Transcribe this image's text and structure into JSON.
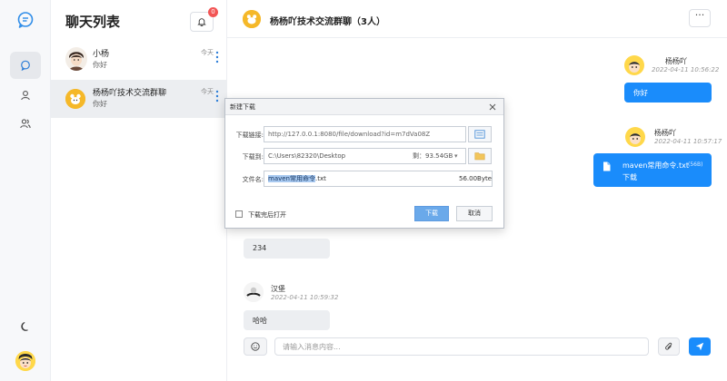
{
  "app": {
    "logo_icon": "chat-bubble-icon",
    "accent": "#1a8cfb"
  },
  "rail": {
    "items": [
      {
        "icon": "chat-icon",
        "active": true
      },
      {
        "icon": "user-icon",
        "active": false
      },
      {
        "icon": "users-icon",
        "active": false
      }
    ],
    "theme_icon": "moon-icon"
  },
  "chat_list": {
    "title": "聊天列表",
    "notification_count": "0",
    "conversations": [
      {
        "name": "小杨",
        "last_message": "你好",
        "time": "今天"
      },
      {
        "name": "杨杨吖技术交流群聊",
        "last_message": "你好",
        "time": "今天"
      }
    ]
  },
  "chat": {
    "title": "杨杨吖技术交流群聊（3人）",
    "messages": [
      {
        "sender": "杨杨吖",
        "time": "2022-04-11 10:56:22",
        "text": "你好"
      },
      {
        "sender": "杨杨吖",
        "time": "2022-04-11 10:57:17",
        "file_name": "maven常用命令.txt",
        "file_size": "(56B)",
        "file_action": "下载"
      },
      {
        "text": "234"
      },
      {
        "sender": "汉堡",
        "time": "2022-04-11 10:59:32",
        "text": "哈哈"
      }
    ],
    "composer_placeholder": "请输入消息内容..."
  },
  "download_dialog": {
    "title": "新建下载",
    "url_label": "下载链接:",
    "url_value": "http://127.0.0.1:8080/file/download?id=m7dVa08Z",
    "path_label": "下载到:",
    "path_value": "C:\\Users\\82320\\Desktop",
    "free_space": "剩：93.54GB",
    "filename_label": "文件名:",
    "filename_selected": "maven常用命令",
    "filename_ext": ".txt",
    "filesize": "56.00Byte",
    "open_after": "下载完后打开",
    "confirm": "下载",
    "cancel": "取消"
  }
}
